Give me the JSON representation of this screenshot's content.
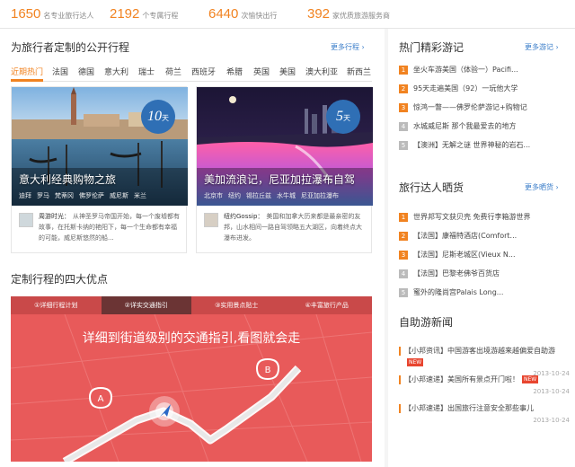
{
  "stats": [
    {
      "num": "1650",
      "label": "名专业旅行达人"
    },
    {
      "num": "2192",
      "label": "个专属行程"
    },
    {
      "num": "6440",
      "label": "次愉快出行"
    },
    {
      "num": "392",
      "label": "家优质旅游服务商"
    }
  ],
  "custom": {
    "title": "为旅行者定制的公开行程",
    "more": "更多行程",
    "tabs": [
      "近期热门",
      "法国",
      "德国",
      "意大利",
      "瑞士",
      "荷兰",
      "西班牙",
      "希腊",
      "英国",
      "美国",
      "澳大利亚",
      "新西兰"
    ],
    "cards": [
      {
        "badge_num": "10",
        "badge_unit": "天",
        "title": "意大利经典购物之旅",
        "tags": [
          "迪拜",
          "罗马",
          "梵蒂冈",
          "佛罗伦萨",
          "威尼斯",
          "米兰"
        ],
        "author": "周游时光：",
        "text": "从神圣罗马帝国开始，每一个废墟都有故事，在托斯卡纳的艳阳下，每一个生命都有幸福的可能，威尼斯悠然的船..."
      },
      {
        "badge_num": "5",
        "badge_unit": "天",
        "title": "美加流浪记，尼亚加拉瀑布自驾",
        "tags": [
          "北京市",
          "纽约",
          "锡拉丘兹",
          "水牛城",
          "尼亚加拉瀑布"
        ],
        "author": "纽约Gossip：",
        "text": "美国和加拿大历来都是最亲密的友邦，山水相间一路自驾领略五大湖区，向着终点大瀑布进发。"
      }
    ]
  },
  "advantages": {
    "title": "定制行程的四大优点",
    "tabs": [
      "①详细行程计划",
      "②详实交通指引",
      "③实用景点贴士",
      "④丰富旅行产品"
    ],
    "active_tab": 1,
    "heading": "详细到街道级别的交通指引,看图就会走",
    "marker_a": "A",
    "marker_b": "B"
  },
  "hot_reviews": {
    "title": "热门精彩游记",
    "more": "更多游记",
    "items": [
      {
        "n": "1",
        "text": "坐火车游美国（体验一）Pacifi..."
      },
      {
        "n": "2",
        "text": "95天走遍美国（92）一玩他大学"
      },
      {
        "n": "3",
        "text": "惊鸿一瞥——佛罗伦萨游记+购物记"
      },
      {
        "n": "4",
        "text": "水城威尼斯 那个我最爱去的地方"
      },
      {
        "n": "5",
        "text": "【澳洲】无解之谜 世界神秘的岩石..."
      }
    ]
  },
  "talents": {
    "title": "旅行达人晒货",
    "more": "更多晒货",
    "items": [
      {
        "n": "1",
        "text": "世界邦写文获贝壳 免费行李箱游世界"
      },
      {
        "n": "2",
        "text": "【法国】康福特酒店(Comfort..."
      },
      {
        "n": "3",
        "text": "【法国】尼斯老城区(Vieux N..."
      },
      {
        "n": "4",
        "text": "【法国】巴黎老佛爷百货店"
      },
      {
        "n": "5",
        "text": "蜜外的隆尚宫Palais Long..."
      }
    ]
  },
  "news": {
    "title": "自助游新闻",
    "items": [
      {
        "text": "【小邦资讯】中国游客出境游越来越偏爱自助游",
        "new": "NEW",
        "date": "2013-10-24"
      },
      {
        "text": "【小邦速递】美国所有景点开门啦！",
        "new": "NEW",
        "date": "2013-10-24"
      },
      {
        "text": "【小邦速递】出国旅行注意安全那些事儿",
        "new": "",
        "date": "2013-10-24"
      }
    ]
  },
  "colors": {
    "accent": "#f18321",
    "link": "#3a7dc9",
    "badge": "#2f6fb5",
    "promo": "#e85a5a"
  }
}
